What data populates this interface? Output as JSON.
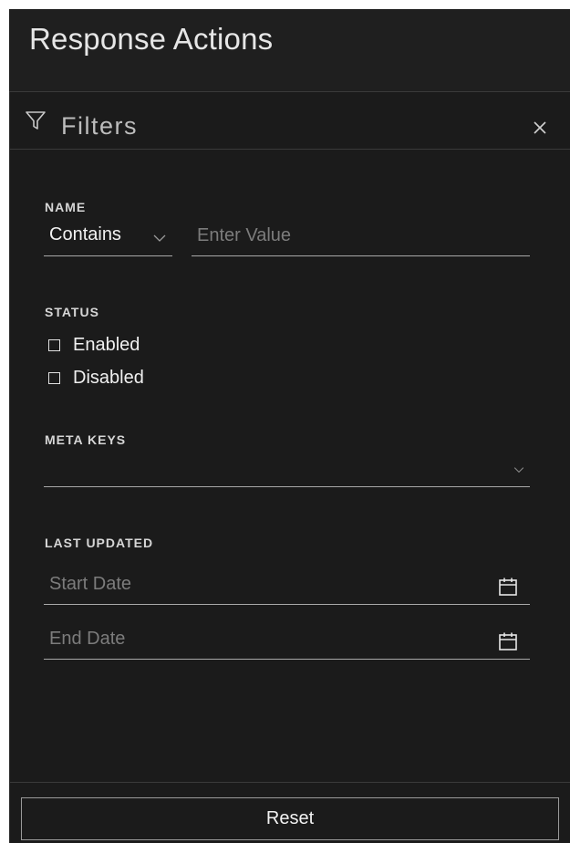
{
  "app": {
    "title": "Response Actions"
  },
  "filters": {
    "title": "Filters",
    "icons": {
      "filter": "filter-funnel-icon",
      "close": "close-icon"
    },
    "name": {
      "label": "NAME",
      "operator": "Contains",
      "value_placeholder": "Enter Value"
    },
    "status": {
      "label": "STATUS",
      "options": [
        {
          "label": "Enabled",
          "checked": false
        },
        {
          "label": "Disabled",
          "checked": false
        }
      ]
    },
    "meta_keys": {
      "label": "META KEYS",
      "value": ""
    },
    "last_updated": {
      "label": "LAST UPDATED",
      "start_placeholder": "Start Date",
      "end_placeholder": "End Date"
    },
    "reset_label": "Reset"
  },
  "colors": {
    "background": "#1a1a1a",
    "header": "#1f1f1f",
    "text": "#f2f2f2",
    "muted": "#7c7c7c",
    "border": "#a8a8a8"
  }
}
